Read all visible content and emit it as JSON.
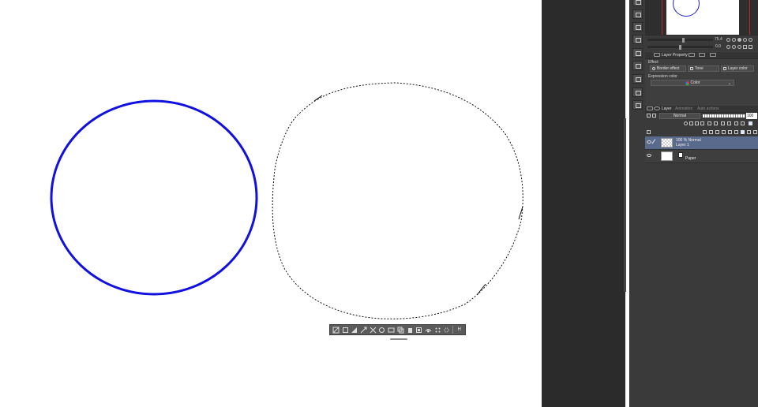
{
  "canvas": {
    "background": "#ffffff",
    "stroke_color": "#1010e0"
  },
  "selection_toolbar": {
    "icons": [
      "deselect-icon",
      "crop-icon",
      "invert-selection-icon",
      "expand-selection-icon",
      "shrink-selection-icon",
      "transform-icon",
      "clear-icon",
      "copy-icon",
      "paste-icon",
      "fill-icon",
      "scale-icon",
      "tone-icon",
      "settings-icon",
      "hide-icon"
    ],
    "end_label": "H"
  },
  "navigator": {
    "zoom_value": "75.4",
    "rotate_value": "0.0"
  },
  "layer_property": {
    "tab_label": "Layer Property",
    "effect_label": "Effect",
    "buttons": [
      {
        "label": "Border effect"
      },
      {
        "label": "Tone"
      },
      {
        "label": "Layer color"
      }
    ],
    "expression_color_label": "Expression color",
    "expression_color_value": "Color"
  },
  "layer_panel": {
    "tabs": [
      {
        "label": "Layer"
      },
      {
        "label": "Animation"
      },
      {
        "label": "Auto actions"
      }
    ],
    "blend_mode": "Normal",
    "opacity": "100",
    "layers": [
      {
        "line1": "100 % Normal",
        "name": "Layer 1",
        "selected": true
      },
      {
        "name": "Paper",
        "selected": false
      }
    ]
  },
  "colors": {
    "panel_bg": "#3e3e3e",
    "gutter_bg": "#2b2b2b",
    "selected_row": "#5a6a8c",
    "nav_frame": "#c32626"
  }
}
